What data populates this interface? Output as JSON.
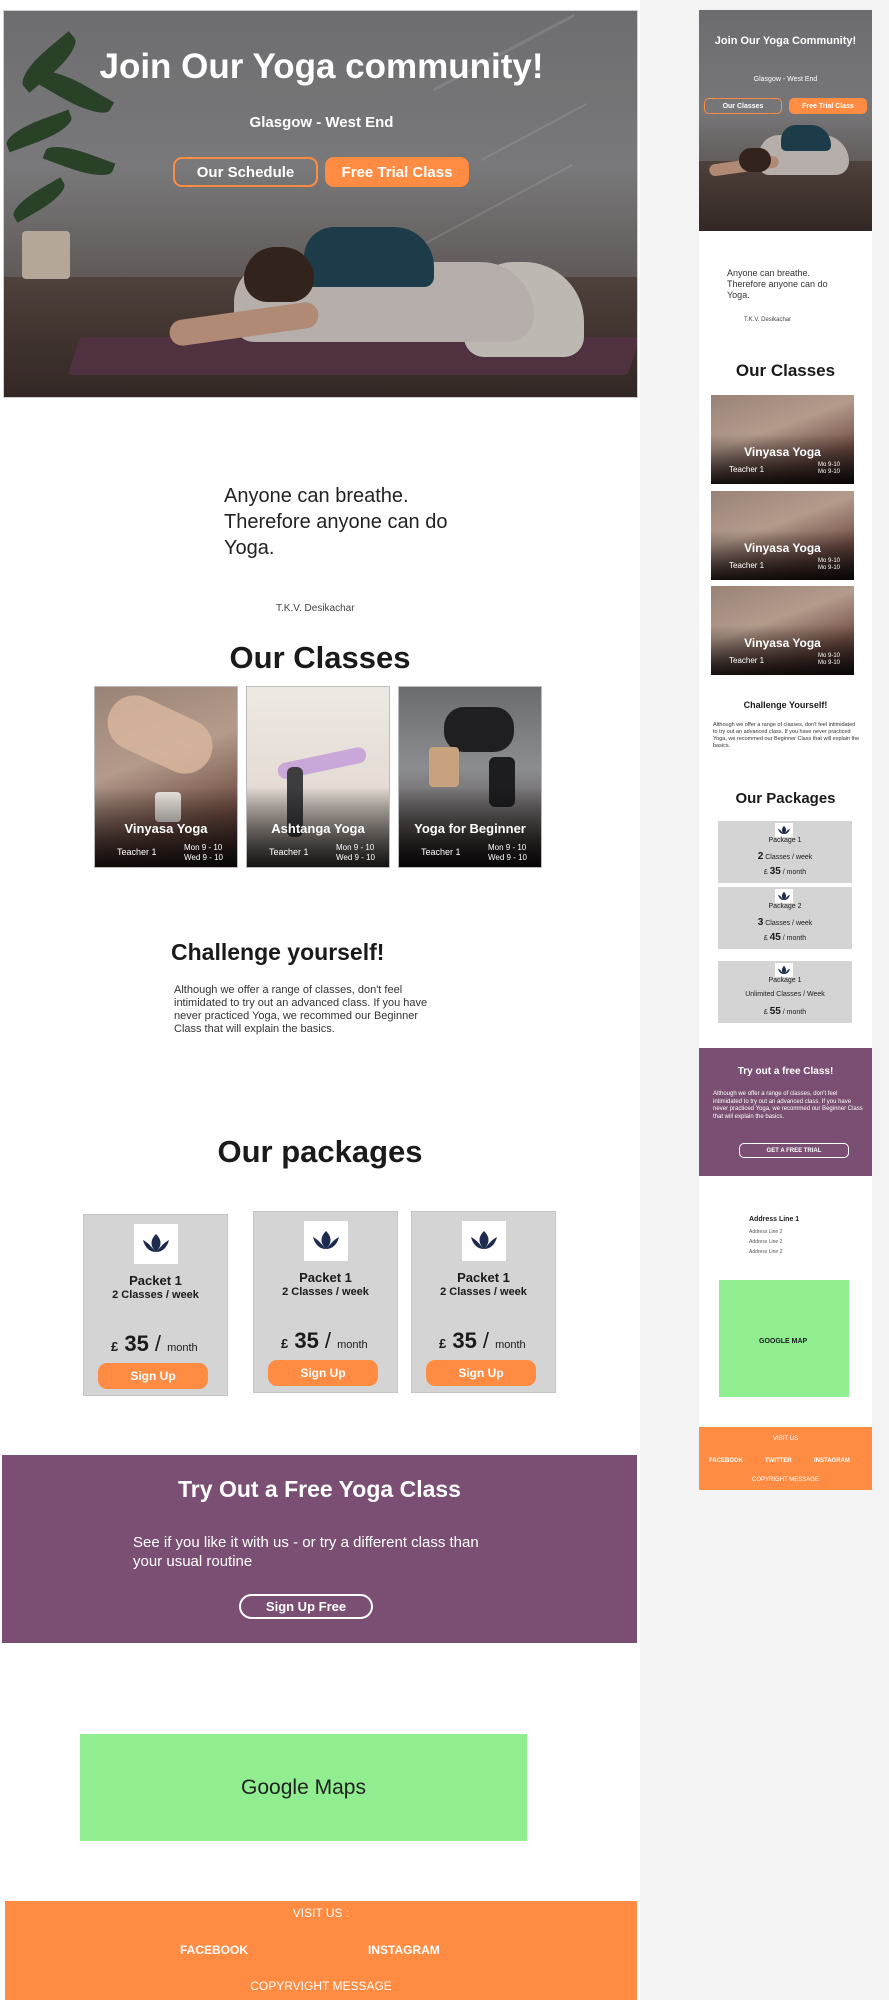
{
  "colors": {
    "accent": "#ff8c42",
    "purple": "#7a4f73",
    "map": "#90ee90",
    "package_bg": "#d4d4d4"
  },
  "desktop": {
    "hero": {
      "title": "Join Our Yoga community!",
      "subtitle": "Glasgow - West End",
      "schedule_button": "Our Schedule",
      "trial_button": "Free Trial Class"
    },
    "quote": {
      "text": "Anyone can breathe. Therefore anyone can do Yoga.",
      "author": "T.K.V. Desikachar"
    },
    "classes": {
      "title": "Our Classes",
      "items": [
        {
          "name": "Vinyasa Yoga",
          "teacher": "Teacher 1",
          "times": [
            "Mon 9 - 10",
            "Wed 9 - 10"
          ]
        },
        {
          "name": "Ashtanga Yoga",
          "teacher": "Teacher 1",
          "times": [
            "Mon 9 - 10",
            "Wed 9 - 10"
          ]
        },
        {
          "name": "Yoga for Beginner",
          "teacher": "Teacher 1",
          "times": [
            "Mon 9 - 10",
            "Wed 9 - 10"
          ]
        }
      ]
    },
    "challenge": {
      "title": "Challenge yourself!",
      "text": "Although we offer a range of classes, don't feel intimidated to try out an advanced class. If you have never practiced Yoga, we recommed our Beginner Class that will explain the basics."
    },
    "packages": {
      "title": "Our packages",
      "items": [
        {
          "name": "Packet 1",
          "classes": "2 Classes / week",
          "currency": "£",
          "price": "35",
          "slash": "/",
          "period": "month",
          "button": "Sign Up",
          "icon": "lotus-icon"
        },
        {
          "name": "Packet 1",
          "classes": "2 Classes / week",
          "currency": "£",
          "price": "35",
          "slash": "/",
          "period": "month",
          "button": "Sign Up",
          "icon": "lotus-icon"
        },
        {
          "name": "Packet 1",
          "classes": "2 Classes / week",
          "currency": "£",
          "price": "35",
          "slash": "/",
          "period": "month",
          "button": "Sign Up",
          "icon": "lotus-icon"
        }
      ]
    },
    "trial": {
      "title": "Try Out a Free Yoga Class",
      "text": "See if you like it with us - or try a different class than your usual routine",
      "button": "Sign Up Free"
    },
    "maps": {
      "label": "Google Maps"
    },
    "footer": {
      "visit": "VISIT US :",
      "facebook": "FACEBOOK",
      "instagram": "INSTAGRAM",
      "copyright": "COPYRVIGHT MESSAGE"
    }
  },
  "mobile": {
    "hero": {
      "title": "Join Our Yoga Community!",
      "subtitle": "Glasgow - West End",
      "classes_button": "Our Classes",
      "trial_button": "Free Trial Class"
    },
    "quote": {
      "text": "Anyone can breathe. Therefore anyone can do Yoga.",
      "author": "T.K.V. Desikachar"
    },
    "classes": {
      "title": "Our Classes",
      "items": [
        {
          "name": "Vinyasa Yoga",
          "teacher": "Teacher 1",
          "times": [
            "Mo 9-10",
            "Mo 9-10"
          ]
        },
        {
          "name": "Vinyasa Yoga",
          "teacher": "Teacher 1",
          "times": [
            "Mo 9-10",
            "Mo 9-10"
          ]
        },
        {
          "name": "Vinyasa Yoga",
          "teacher": "Teacher 1",
          "times": [
            "Mo 9-10",
            "Mo 9-10"
          ]
        }
      ]
    },
    "challenge": {
      "title": "Challenge Yourself!",
      "text": "Although we offer a range of classes, don't feel intimidated to try out an advanced class. If you have never practiced Yoga, we recommed our Beginner Class that will explain the basics."
    },
    "packages": {
      "title": "Our Packages",
      "items": [
        {
          "name": "Package 1",
          "count": "2",
          "classes": "Classes / week",
          "currency": "£",
          "price": "35",
          "period": "/ month"
        },
        {
          "name": "Package 2",
          "count": "3",
          "classes": "Classes / week",
          "currency": "£",
          "price": "45",
          "period": "/ month"
        },
        {
          "name": "Package 1",
          "count": "",
          "classes": "Unlimited Classes / Week",
          "currency": "£",
          "price": "55",
          "period": "/ month"
        }
      ]
    },
    "trial": {
      "title": "Try out a free Class!",
      "text": "Although we offer a range of classes, don't feel intimidated to try out an advanced class. If you have never practiced Yoga, we recommed our Beginner Class that will explain the basics.",
      "button": "GET A FREE TRIAL"
    },
    "address": {
      "line1": "Address Line 1",
      "lines": [
        "Address Line 2",
        "Address Line 2",
        "Address Line 2"
      ]
    },
    "maps": {
      "label": "GOOGLE MAP"
    },
    "footer": {
      "visit": "VISIT US",
      "facebook": "FACEBOOK",
      "twitter": "TWITTER",
      "instagram": "INSTAGRAM",
      "copyright": "COPYRIGHT MESSAGE"
    }
  }
}
